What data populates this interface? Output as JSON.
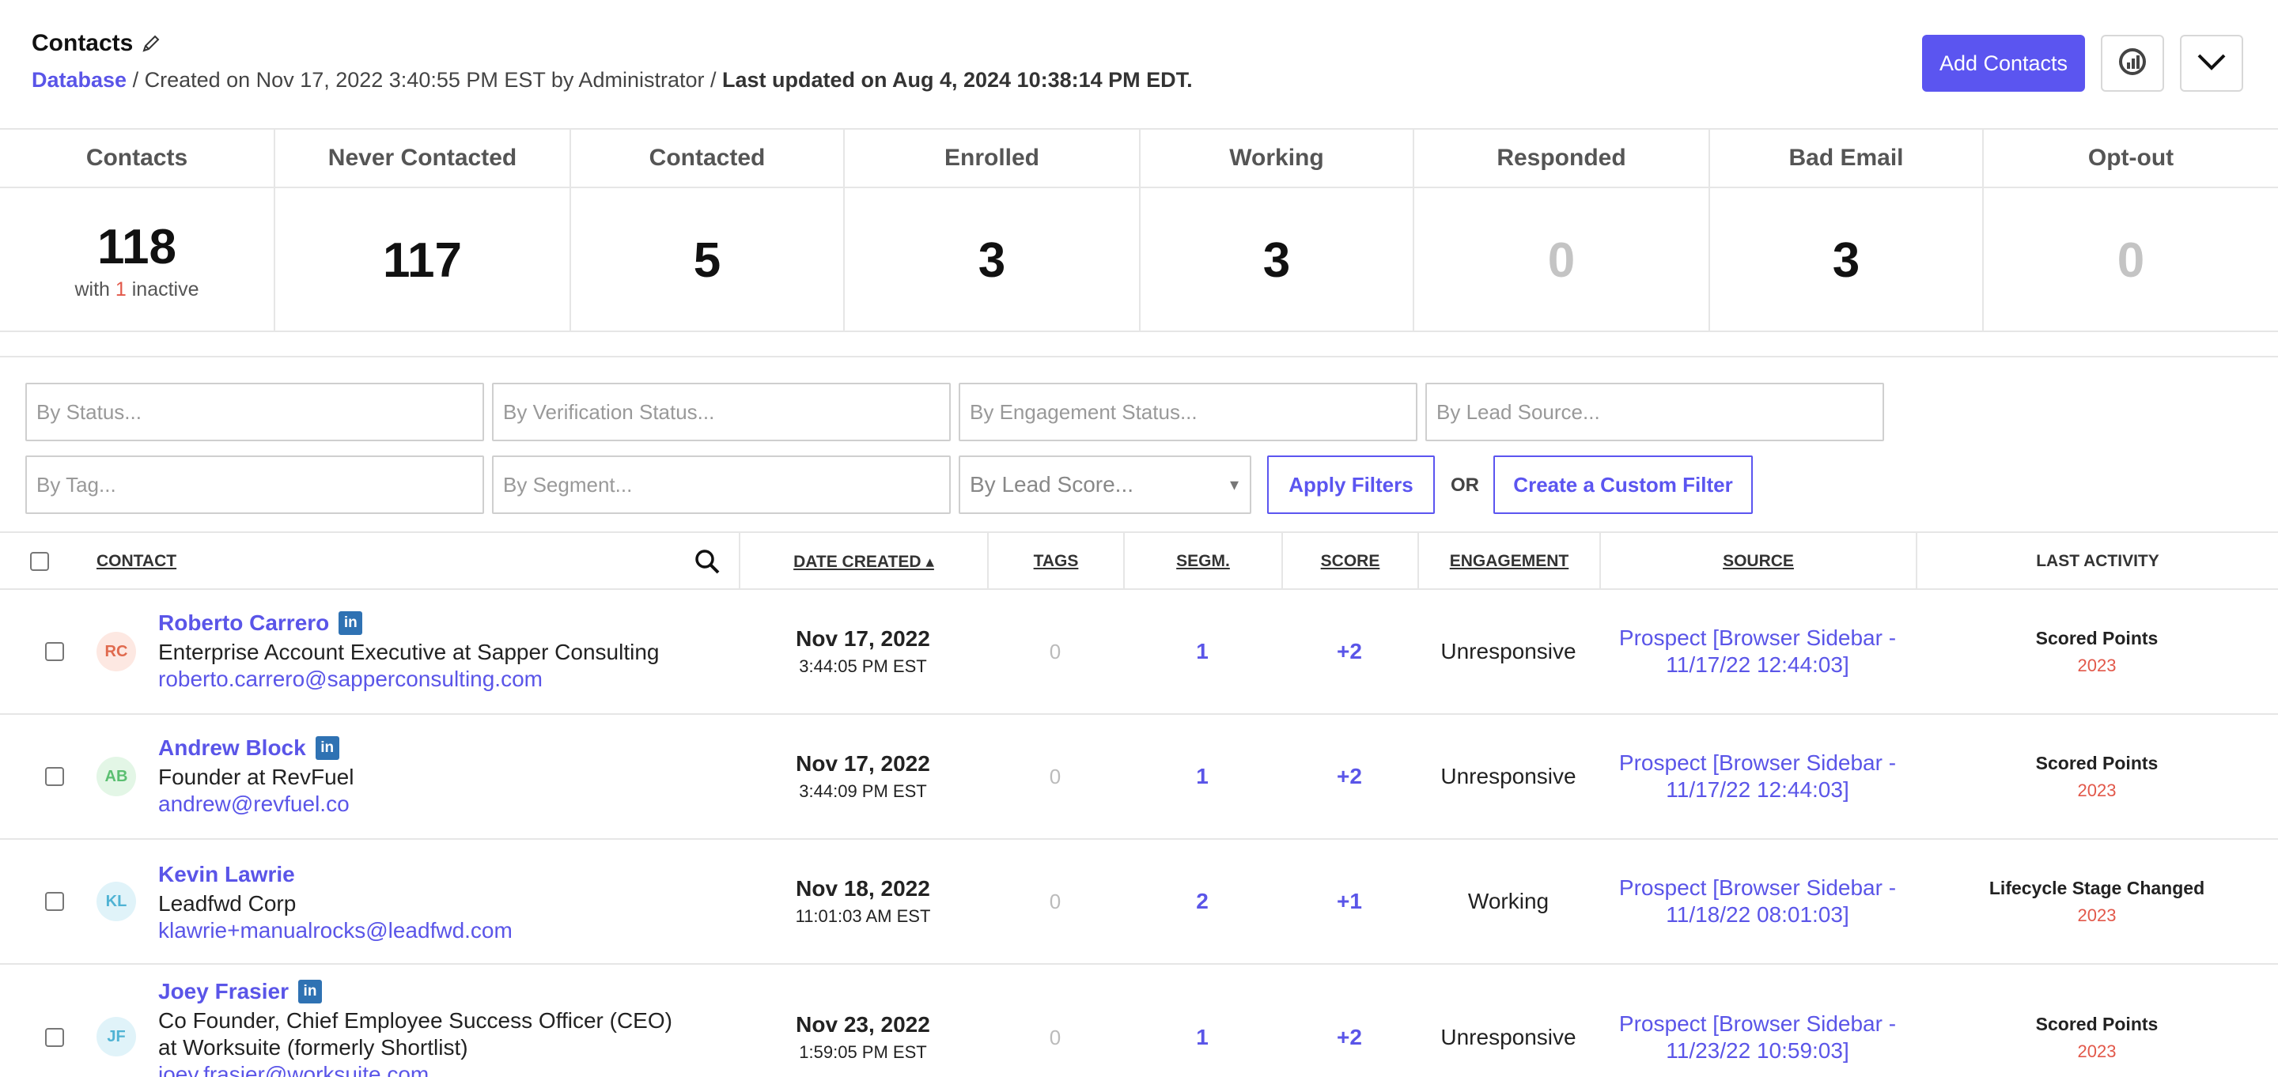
{
  "header": {
    "title": "Contacts",
    "breadcrumb_link": "Database",
    "created_text": " / Created on Nov 17, 2022 3:40:55 PM EST by Administrator / ",
    "updated_text": "Last updated on Aug 4, 2024 10:38:14 PM EDT.",
    "add_contacts_label": "Add Contacts"
  },
  "stats": [
    {
      "label": "Contacts",
      "value": "118",
      "sub_prefix": "with ",
      "sub_count": "1",
      "sub_suffix": " inactive"
    },
    {
      "label": "Never Contacted",
      "value": "117"
    },
    {
      "label": "Contacted",
      "value": "5"
    },
    {
      "label": "Enrolled",
      "value": "3"
    },
    {
      "label": "Working",
      "value": "3"
    },
    {
      "label": "Responded",
      "value": "0"
    },
    {
      "label": "Bad Email",
      "value": "3"
    },
    {
      "label": "Opt-out",
      "value": "0"
    }
  ],
  "filters": {
    "status": "By Status...",
    "verification": "By Verification Status...",
    "engagement": "By Engagement Status...",
    "lead_source": "By Lead Source...",
    "tag": "By Tag...",
    "segment": "By Segment...",
    "lead_score": "By Lead Score...",
    "apply_label": "Apply Filters",
    "or_label": "OR",
    "custom_label": "Create a Custom Filter"
  },
  "table": {
    "columns": {
      "contact": "CONTACT",
      "date_created": "DATE CREATED ▴",
      "tags": "TAGS",
      "segm": "SEGM.",
      "score": "SCORE",
      "engagement": "ENGAGEMENT",
      "source": "SOURCE",
      "last_activity": "LAST ACTIVITY"
    },
    "rows": [
      {
        "initials": "RC",
        "avatar_bg": "#fde8e2",
        "avatar_fg": "#e06a4e",
        "name": "Roberto Carrero",
        "linkedin": "in",
        "title": "Enterprise Account Executive at Sapper Consulting",
        "email": "roberto.carrero@sapperconsulting.com",
        "date": "Nov 17, 2022",
        "time": "3:44:05 PM EST",
        "tags": "0",
        "segm": "1",
        "score": "+2",
        "engagement": "Unresponsive",
        "source": "Prospect [Browser Sidebar - 11/17/22 12:44:03]",
        "activity": "Scored Points",
        "activity_year": "2023"
      },
      {
        "initials": "AB",
        "avatar_bg": "#e3f6e6",
        "avatar_fg": "#5bbf71",
        "name": "Andrew Block",
        "linkedin": "in",
        "title": "Founder at RevFuel",
        "email": "andrew@revfuel.co",
        "date": "Nov 17, 2022",
        "time": "3:44:09 PM EST",
        "tags": "0",
        "segm": "1",
        "score": "+2",
        "engagement": "Unresponsive",
        "source": "Prospect [Browser Sidebar - 11/17/22 12:44:03]",
        "activity": "Scored Points",
        "activity_year": "2023"
      },
      {
        "initials": "KL",
        "avatar_bg": "#e0f3f9",
        "avatar_fg": "#4fb3d4",
        "name": "Kevin Lawrie",
        "linkedin": "",
        "title": "Leadfwd Corp",
        "email": "klawrie+manualrocks@leadfwd.com",
        "date": "Nov 18, 2022",
        "time": "11:01:03 AM EST",
        "tags": "0",
        "segm": "2",
        "score": "+1",
        "engagement": "Working",
        "source": "Prospect [Browser Sidebar - 11/18/22 08:01:03]",
        "activity": "Lifecycle Stage Changed",
        "activity_year": "2023"
      },
      {
        "initials": "JF",
        "avatar_bg": "#e0f3f9",
        "avatar_fg": "#4fb3d4",
        "name": "Joey Frasier",
        "linkedin": "in",
        "title": "Co Founder, Chief Employee Success Officer (CEO) at Worksuite (formerly Shortlist)",
        "email": "joey.frasier@worksuite.com",
        "date": "Nov 23, 2022",
        "time": "1:59:05 PM EST",
        "tags": "0",
        "segm": "1",
        "score": "+2",
        "engagement": "Unresponsive",
        "source": "Prospect [Browser Sidebar - 11/23/22 10:59:03]",
        "activity": "Scored Points",
        "activity_year": "2023"
      }
    ]
  }
}
